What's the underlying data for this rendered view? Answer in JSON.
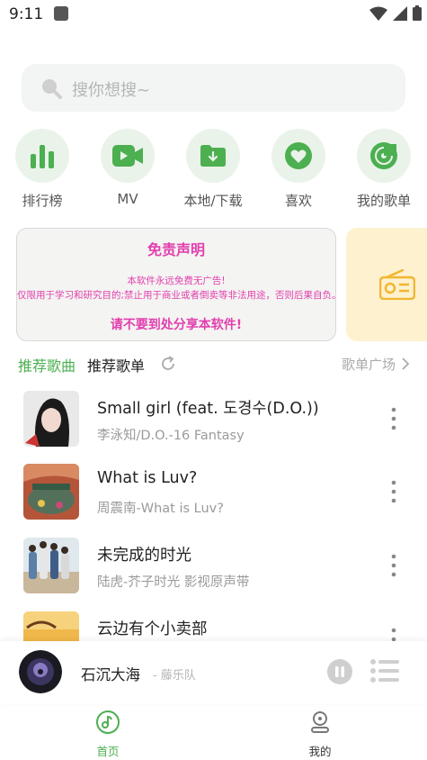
{
  "status_bar": {
    "time": "9:11"
  },
  "search": {
    "placeholder": "搜你想搜~"
  },
  "quick_menu": [
    {
      "label": "排行榜",
      "icon": "bar-chart-icon"
    },
    {
      "label": "MV",
      "icon": "video-camera-icon"
    },
    {
      "label": "本地/下载",
      "icon": "download-folder-icon"
    },
    {
      "label": "喜欢",
      "icon": "heart-icon"
    },
    {
      "label": "我的歌单",
      "icon": "playlist-disc-icon"
    }
  ],
  "banner": {
    "title": "免责声明",
    "line1": "本软件永远免费无广告!",
    "line2": "仅限用于学习和研究目的;禁止用于商业或者倒卖等非法用途，否则后果自负。",
    "warning": "请不要到处分享本软件!"
  },
  "section": {
    "tab_songs": "推荐歌曲",
    "tab_playlists": "推荐歌单",
    "playlist_square": "歌单广场"
  },
  "songs": [
    {
      "title": "Small girl (feat. 도경수(D.O.))",
      "subtitle": "李泳知/D.O.-16 Fantasy"
    },
    {
      "title": "What is Luv?",
      "subtitle": "周震南-What is Luv?"
    },
    {
      "title": "未完成的时光",
      "subtitle": "陆虎-芥子时光 影视原声带"
    },
    {
      "title": "云边有个小卖部",
      "subtitle": ""
    }
  ],
  "player": {
    "title": "石沉大海",
    "artist": "- 藤乐队"
  },
  "bottom_nav": {
    "home": "首页",
    "mine": "我的"
  },
  "colors": {
    "accent": "#4caf50",
    "banner_text": "#e23fae",
    "icon_bg": "#eaf3ea"
  }
}
